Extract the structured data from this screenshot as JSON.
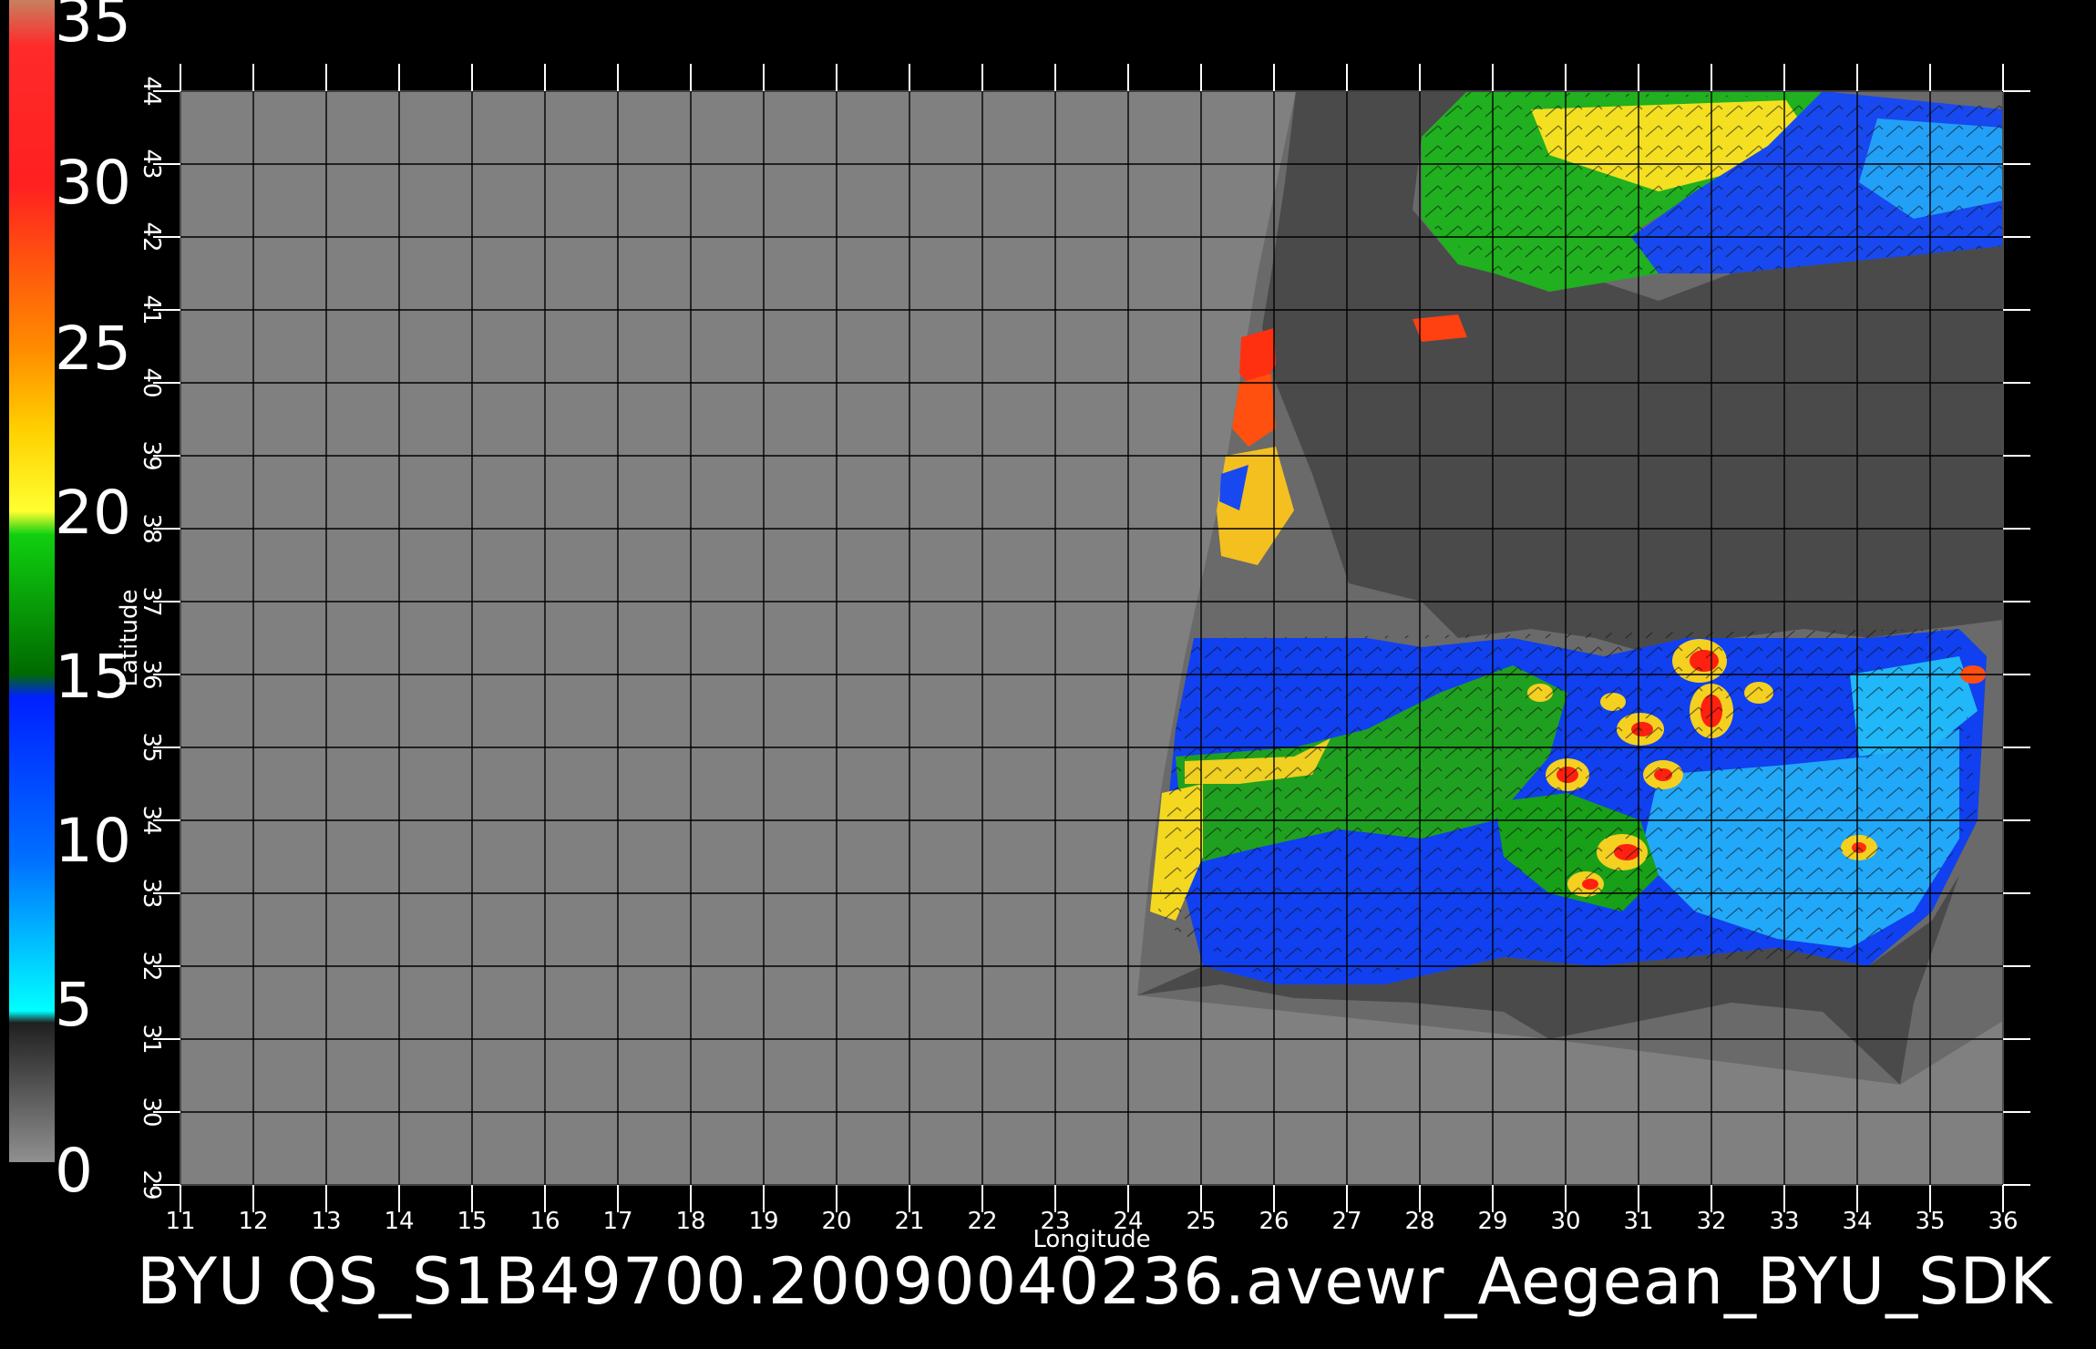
{
  "colorbar": {
    "labels": [
      "35",
      "30",
      "25",
      "20",
      "15",
      "10",
      "5",
      "0"
    ],
    "colors": [
      "#c07050",
      "#ff2020",
      "#ff6a10",
      "#ffd000",
      "#10c010",
      "#0030ff",
      "#00b0ff",
      "#808080"
    ]
  },
  "map": {
    "lon_ticks": [
      "11",
      "12",
      "13",
      "14",
      "15",
      "16",
      "17",
      "18",
      "19",
      "20",
      "21",
      "22",
      "23",
      "24",
      "25",
      "26",
      "27",
      "28",
      "29",
      "30",
      "31",
      "32",
      "33",
      "34",
      "35",
      "36"
    ],
    "lat_ticks": [
      "29",
      "30",
      "31",
      "32",
      "33",
      "34",
      "35",
      "36",
      "37",
      "38",
      "39",
      "40",
      "41",
      "42",
      "43",
      "44"
    ],
    "xlabel": "Longitude",
    "ylabel": "Latitude",
    "land_color": "#4a4a4a",
    "nodata_color": "#808080",
    "swath_edge_color": "#6a6a6a"
  },
  "caption": "BYU QS_S1B49700.20090040236.avewr_Aegean_BYU_SDK"
}
